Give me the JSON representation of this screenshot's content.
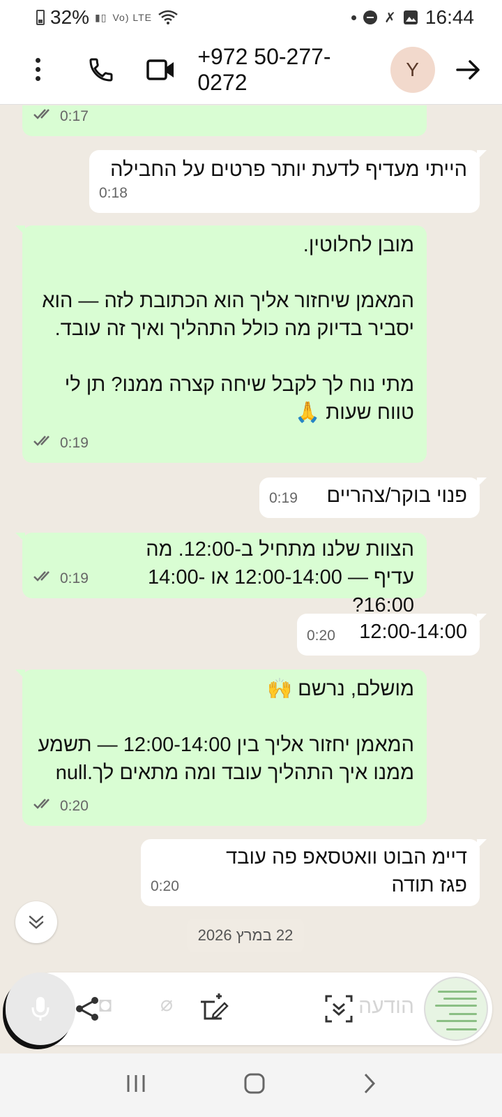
{
  "status_bar": {
    "battery": "32%",
    "network": "Vo) LTE",
    "time": "16:44"
  },
  "header": {
    "contact": "+972 50-277-0272",
    "avatar_letter": "Y"
  },
  "messages": [
    {
      "dir": "out",
      "text": "",
      "time": "0:17",
      "ticks": "✓✓"
    },
    {
      "dir": "in",
      "text": "הייתי מעדיף לדעת יותר פרטים על החבילה",
      "time": "0:18"
    },
    {
      "dir": "out",
      "text": "מובן לחלוטין.\n\nהמאמן שיחזור אליך הוא הכתובת לזה — הוא יסביר בדיוק מה כולל התהליך ואיך זה עובד.\n\nמתי נוח לך לקבל שיחה קצרה ממנו? תן לי טווח שעות 🙏",
      "time": "0:19",
      "ticks": "✓✓"
    },
    {
      "dir": "in",
      "text": "פנוי בוקר/צהריים",
      "time": "0:19"
    },
    {
      "dir": "out",
      "text": "הצוות שלנו מתחיל ב-12:00. מה עדיף — 12:00-14:00 או 14:00-16:00?",
      "time": "0:19",
      "ticks": "✓✓"
    },
    {
      "dir": "in",
      "text": "12:00-14:00",
      "time": "0:20"
    },
    {
      "dir": "out",
      "text": "מושלם, נרשם 🙌\n\nהמאמן יחזור אליך בין 12:00-14:00 — תשמע ממנו איך התהליך עובד ומה מתאים לך.null",
      "time": "0:20",
      "ticks": "✓✓"
    },
    {
      "dir": "in",
      "text": "דיימ הבוט וואטסאפ פה עובד פגז תודה",
      "time": "0:20"
    }
  ],
  "date_chip": "22 במרץ 2026",
  "composer": {
    "ghost_text": "הודעה"
  },
  "colors": {
    "outgoing": "#d9fdd3",
    "incoming": "#ffffff",
    "chat_bg": "#efeae2"
  }
}
